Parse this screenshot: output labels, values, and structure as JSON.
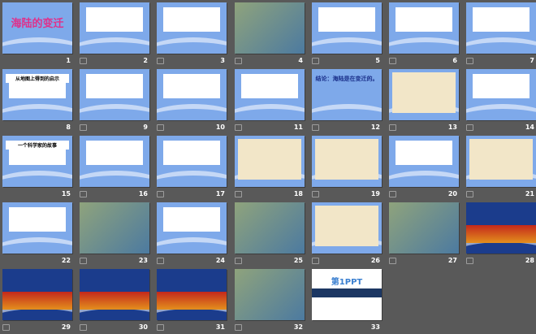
{
  "view": "slide-sorter",
  "slides": [
    {
      "number": "1",
      "kind": "blue",
      "title": "海陆的变迁"
    },
    {
      "number": "2",
      "kind": "blue",
      "title": ""
    },
    {
      "number": "3",
      "kind": "blue",
      "title": ""
    },
    {
      "number": "4",
      "kind": "photo",
      "title": ""
    },
    {
      "number": "5",
      "kind": "blue",
      "title": ""
    },
    {
      "number": "6",
      "kind": "blue",
      "title": ""
    },
    {
      "number": "7",
      "kind": "blue",
      "title": ""
    },
    {
      "number": "8",
      "kind": "blue",
      "title": "从地图上得到的启示"
    },
    {
      "number": "9",
      "kind": "blue",
      "title": ""
    },
    {
      "number": "10",
      "kind": "blue",
      "title": ""
    },
    {
      "number": "11",
      "kind": "blue",
      "title": ""
    },
    {
      "number": "12",
      "kind": "blue",
      "title": "结论：海陆是在变迁的。"
    },
    {
      "number": "13",
      "kind": "map",
      "title": ""
    },
    {
      "number": "14",
      "kind": "blue",
      "title": ""
    },
    {
      "number": "15",
      "kind": "blue",
      "title": "一个科学家的故事"
    },
    {
      "number": "16",
      "kind": "blue",
      "title": ""
    },
    {
      "number": "17",
      "kind": "blue",
      "title": ""
    },
    {
      "number": "18",
      "kind": "map",
      "title": ""
    },
    {
      "number": "19",
      "kind": "map",
      "title": ""
    },
    {
      "number": "20",
      "kind": "blue",
      "title": ""
    },
    {
      "number": "21",
      "kind": "map",
      "title": ""
    },
    {
      "number": "22",
      "kind": "blue",
      "title": ""
    },
    {
      "number": "23",
      "kind": "photo",
      "title": ""
    },
    {
      "number": "24",
      "kind": "blue",
      "title": ""
    },
    {
      "number": "25",
      "kind": "photo",
      "title": ""
    },
    {
      "number": "26",
      "kind": "map",
      "title": ""
    },
    {
      "number": "27",
      "kind": "photo",
      "title": ""
    },
    {
      "number": "28",
      "kind": "geo",
      "title": ""
    },
    {
      "number": "29",
      "kind": "geo",
      "title": ""
    },
    {
      "number": "30",
      "kind": "geo",
      "title": ""
    },
    {
      "number": "31",
      "kind": "geo",
      "title": ""
    },
    {
      "number": "32",
      "kind": "photo",
      "title": ""
    },
    {
      "number": "33",
      "kind": "white",
      "title": "第1PPT"
    }
  ]
}
